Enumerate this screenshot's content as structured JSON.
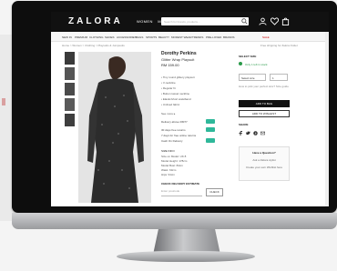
{
  "header": {
    "logo": "ZALORA",
    "nav": [
      "WOMEN",
      "MEN",
      "KIDS"
    ],
    "search_placeholder": "Search for brands, products..."
  },
  "categories": [
    "NEW IN",
    "PREMIUM",
    "CLOTHING",
    "SHOES",
    "ACCESSORIES",
    "BAGS",
    "SPORTS",
    "BEAUTY",
    "MODEST WEAR",
    "TRENDS",
    "PRE-LOVED",
    "BRANDS",
    "SALE"
  ],
  "breadcrumb": "Home > Women > Clothing > Playsuits & Jumpsuits",
  "shipping_info": "Free shipping for Zalora Outlet",
  "product": {
    "brand": "Dorothy Perkins",
    "name": "Glitter Wrap Playsuit",
    "price": "RM 159.00",
    "details": [
      "• Tiny round glittery playsuit",
      "• V-neckline",
      "• Regular fit",
      "• Button tassel neckline",
      "• Elastic/short waistband",
      "• Unlined fabric"
    ],
    "see_more": "See more ▸",
    "delivery_label": "Delivery above RM77",
    "delivery_check": "Yes",
    "returns_label": "30 days free returns",
    "returns_check": "Yes",
    "cod_label": "7 days for free online returns",
    "cod_check": "Yes",
    "cash_label": "Cash On Delivery",
    "cash_check": "Yes"
  },
  "size_info": {
    "header": "SIZE INFO",
    "lines": [
      "Size on Model: UK 8",
      "Model Height: 178cm",
      "Model Bust: 84cm",
      "Waist: 63cm",
      "Hips: 91cm"
    ]
  },
  "delivery": {
    "header": "CHECK DELIVERY ESTIMATE",
    "placeholder": "Enter postcode",
    "button": "CHECK"
  },
  "select": {
    "title": "SELECT SIZE",
    "stock": "Only 1 left in stock",
    "size_value": "Select size",
    "qty_value": "1",
    "size_guide": "How to pick your perfect size? Size guide"
  },
  "actions": {
    "add_to_bag": "ADD TO BAG",
    "add_to_wishlist": "ADD TO WISHLIST"
  },
  "share": {
    "title": "SHARE"
  },
  "help": {
    "title": "Have a Question?",
    "lines": [
      "Ask a Zalora stylist",
      "Create your own Wishlist here"
    ]
  },
  "colors": {
    "top_bar": "#111111",
    "stock_green": "#2a9a4a",
    "check_teal": "#2fb89a"
  }
}
